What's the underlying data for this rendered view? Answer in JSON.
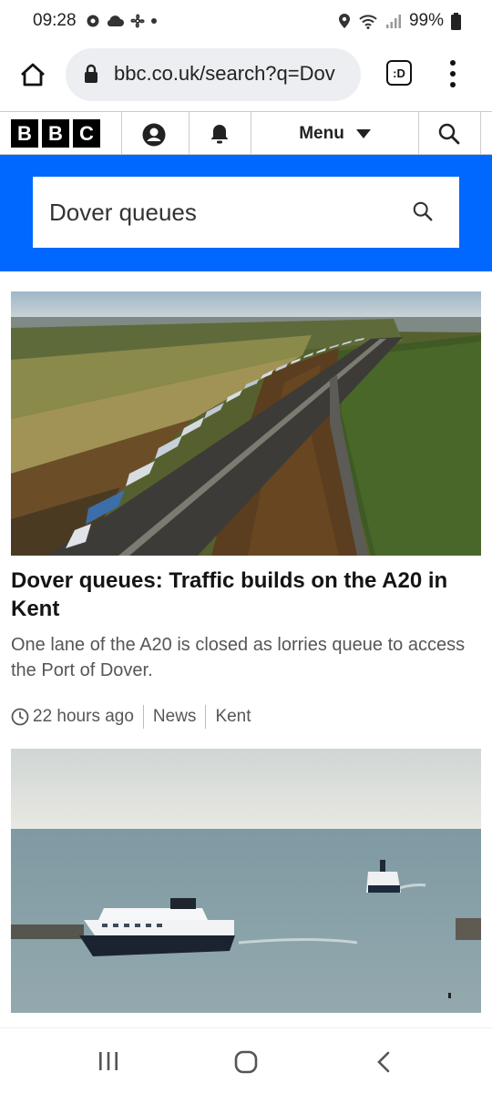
{
  "status_bar": {
    "time": "09:28",
    "battery": "99%",
    "icons": [
      "screen-record-icon",
      "cloud-icon",
      "fan-icon",
      "notification-dot-icon",
      "location-icon",
      "wifi-icon",
      "signal-icon",
      "battery-icon"
    ]
  },
  "browser": {
    "url": "bbc.co.uk/search?q=Dov",
    "tabs_label": ":D"
  },
  "bbc_nav": {
    "logo_letters": [
      "B",
      "B",
      "C"
    ],
    "menu_label": "Menu"
  },
  "search": {
    "query": "Dover queues"
  },
  "results": [
    {
      "title": "Dover queues: Traffic builds on the A20 in Kent",
      "summary": "One lane of the A20 is closed as lorries queue to access the Port of Dover.",
      "time": "22 hours ago",
      "section": "News",
      "region": "Kent",
      "image": "aerial-motorway-lorry-queue"
    },
    {
      "image": "ferries-port-of-dover"
    }
  ],
  "colors": {
    "bbc_blue": "#0068ff",
    "text_dark": "#141414",
    "text_muted": "#545658"
  }
}
